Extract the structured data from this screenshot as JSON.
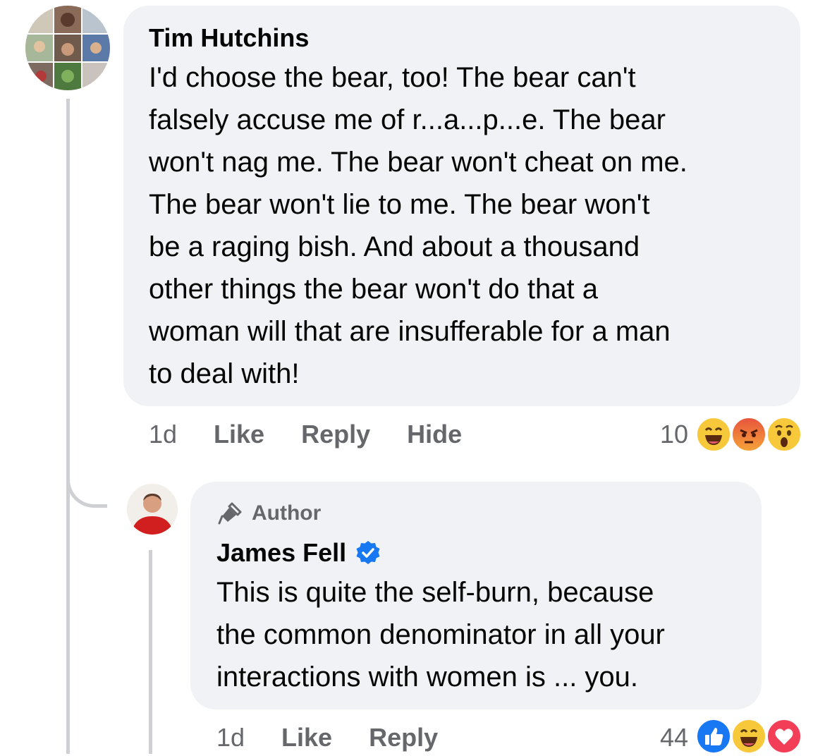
{
  "comment": {
    "author": "Tim Hutchins",
    "lines": [
      "I'd choose the bear, too! The bear can't",
      "falsely accuse me of r...a...p...e. The bear",
      "won't nag me. The bear won't cheat on me.",
      "The bear won't lie to me. The bear won't",
      "be a raging bish. And about a thousand",
      "other things the bear won't do that a",
      "woman will that are insufferable for a man",
      "to deal with!"
    ],
    "time": "1d",
    "like_label": "Like",
    "reply_label": "Reply",
    "hide_label": "Hide",
    "reaction_count": "10",
    "reactions": [
      "haha-icon",
      "angry-icon",
      "wow-icon"
    ]
  },
  "reply": {
    "badge": "Author",
    "author": "James Fell",
    "verified_icon": "verified-badge-icon",
    "lines": [
      "This is quite the self-burn, because",
      "the common denominator in all your",
      "interactions with women is ... you."
    ],
    "time": "1d",
    "like_label": "Like",
    "reply_label": "Reply",
    "reaction_count": "44",
    "reactions": [
      "like-icon",
      "haha-icon",
      "love-icon"
    ]
  },
  "colors": {
    "bubble": "#f0f2f5",
    "secondary_text": "#65676b",
    "verified_blue": "#1877f2",
    "thread_line": "#ced0d4"
  }
}
